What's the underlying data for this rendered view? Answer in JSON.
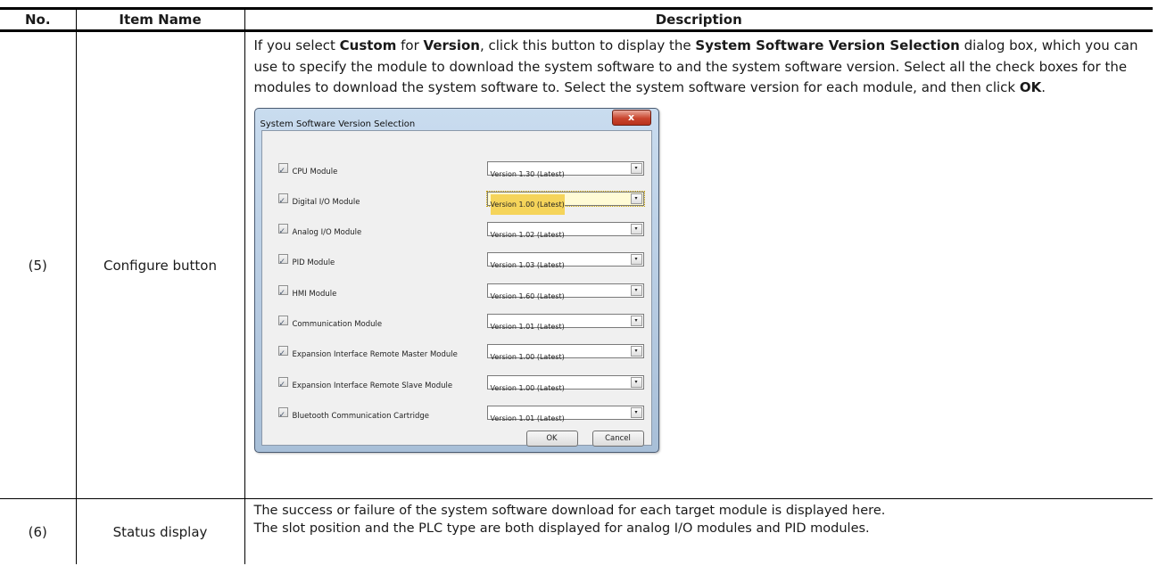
{
  "headers": {
    "no": "No.",
    "item_name": "Item Name",
    "description": "Description"
  },
  "row5": {
    "no": "(5)",
    "item_name": "Configure button",
    "desc": {
      "t1": "If you select ",
      "b1": "Custom",
      "t2": " for ",
      "b2": "Version",
      "t3": ", click this button to display the ",
      "b3": "System Software Version Selection",
      "t4": " dialog box, which you can use to specify the module to download the system software to and the system software version. Select all the check boxes for the modules to download the system software to. Select the system software version for each module, and then click ",
      "b4": "OK",
      "t5": "."
    }
  },
  "dialog": {
    "title": "System Software Version Selection",
    "close_glyph": "x",
    "modules": [
      {
        "label": "CPU Module",
        "version": "Version 1.30 (Latest)"
      },
      {
        "label": "Digital I/O Module",
        "version": "Version 1.00 (Latest)"
      },
      {
        "label": "Analog I/O Module",
        "version": "Version 1.02 (Latest)"
      },
      {
        "label": "PID Module",
        "version": "Version 1.03 (Latest)"
      },
      {
        "label": "HMI Module",
        "version": "Version 1.60 (Latest)"
      },
      {
        "label": "Communication Module",
        "version": "Version 1.01 (Latest)"
      },
      {
        "label": "Expansion Interface Remote Master Module",
        "version": "Version 1.00 (Latest)"
      },
      {
        "label": "Expansion Interface Remote Slave Module",
        "version": "Version 1.00 (Latest)"
      },
      {
        "label": "Bluetooth Communication Cartridge",
        "version": "Version 1.01 (Latest)"
      }
    ],
    "ok_label": "OK",
    "cancel_label": "Cancel",
    "dropdown_glyph": "▾"
  },
  "row6": {
    "no": "(6)",
    "item_name": "Status display",
    "line1": "The success or failure of the system software download for each target module is displayed here.",
    "line2": "The slot position and the PLC type are both displayed for analog I/O modules and PID modules."
  }
}
